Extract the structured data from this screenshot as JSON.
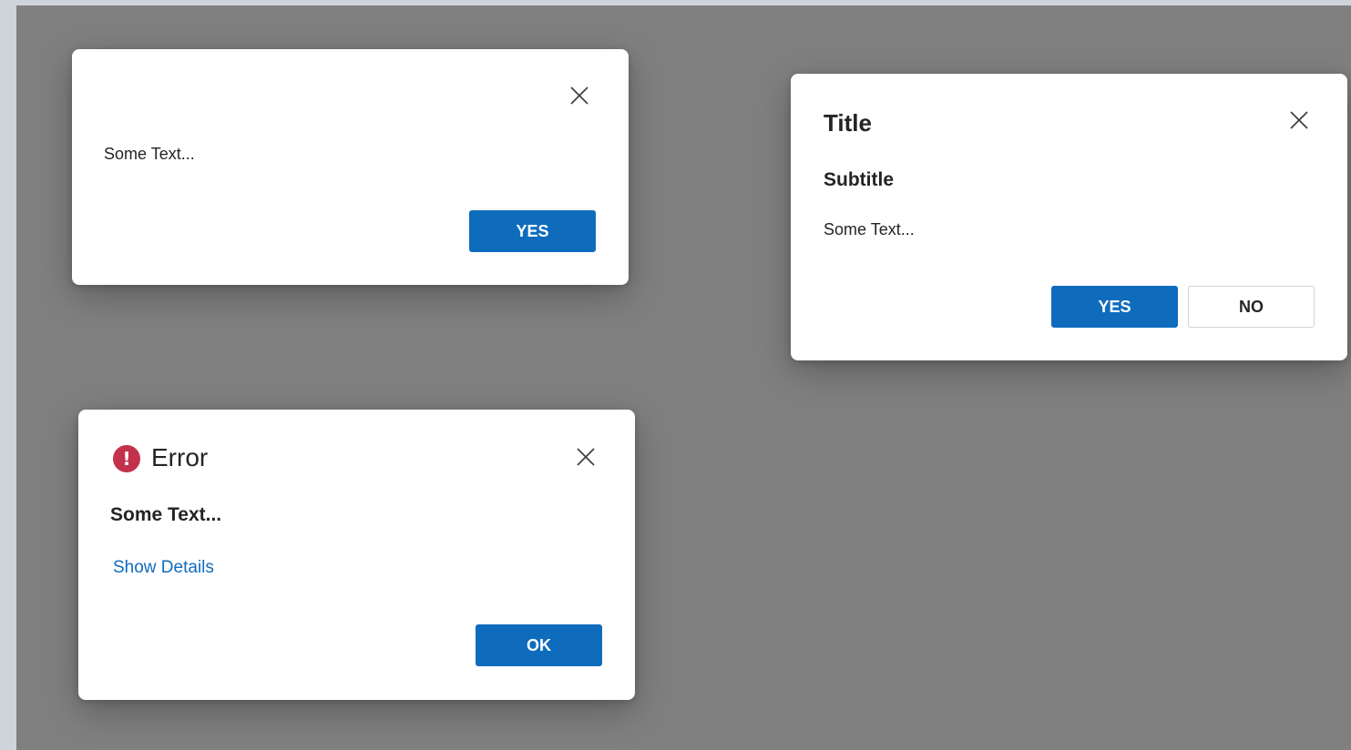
{
  "dialog_simple": {
    "body_text": "Some Text...",
    "yes_label": "YES"
  },
  "dialog_titled": {
    "title": "Title",
    "subtitle": "Subtitle",
    "body_text": "Some Text...",
    "yes_label": "YES",
    "no_label": "NO"
  },
  "dialog_error": {
    "icon": "error-icon",
    "title": "Error",
    "message": "Some Text...",
    "details_link": "Show Details",
    "ok_label": "OK"
  },
  "colors": {
    "primary": "#0f6cbd",
    "error": "#c4314b",
    "overlay": "#808080"
  }
}
